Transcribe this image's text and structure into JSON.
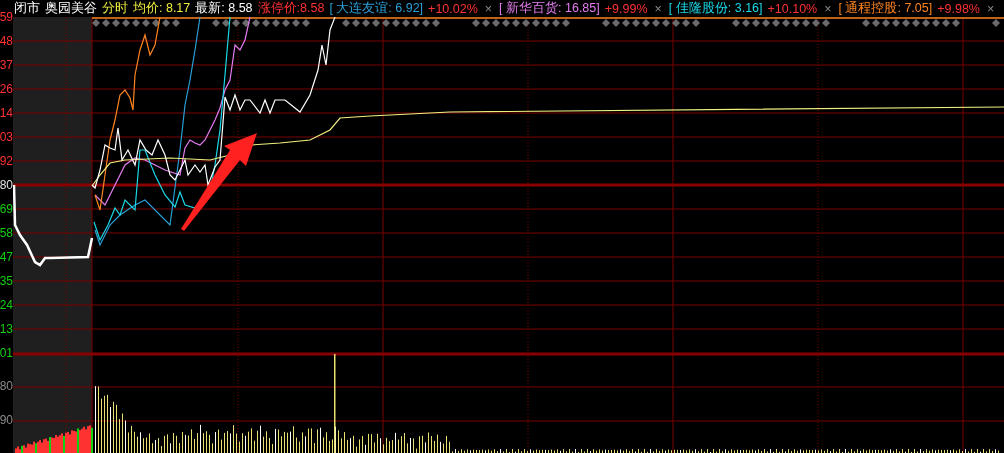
{
  "header": {
    "status": "闭市",
    "stock_name": "奥园美谷",
    "mode": "分时",
    "average": "均价: 8.17",
    "latest": "最新: 8.58",
    "limit_up": "涨停价:8.58"
  },
  "compare": [
    {
      "name": "[ 大连友谊: 6.92]",
      "change": "+10.02%",
      "close": "×",
      "color": "#2a9fd6"
    },
    {
      "name": "[ 新华百货: 16.85]",
      "change": "+9.99%",
      "close": "×",
      "color": "#e47cf0"
    },
    {
      "name": "[ 佳隆股份: 3.16]",
      "change": "+10.10%",
      "close": "×",
      "color": "#19d8e8"
    },
    {
      "name": "[ 通程控股: 7.05]",
      "change": "+9.98%",
      "close": "×",
      "color": "#ff8420"
    }
  ],
  "price_axis": [
    {
      "label": "59",
      "kind": "up"
    },
    {
      "label": "48",
      "kind": "up"
    },
    {
      "label": "37",
      "kind": "up"
    },
    {
      "label": "26",
      "kind": "up"
    },
    {
      "label": "14",
      "kind": "up"
    },
    {
      "label": "03",
      "kind": "up"
    },
    {
      "label": "92",
      "kind": "up"
    },
    {
      "label": "80",
      "kind": "flat"
    },
    {
      "label": "69",
      "kind": "down"
    },
    {
      "label": "58",
      "kind": "down"
    },
    {
      "label": "47",
      "kind": "down"
    },
    {
      "label": "35",
      "kind": "down"
    },
    {
      "label": "24",
      "kind": "down"
    },
    {
      "label": "13",
      "kind": "down"
    },
    {
      "label": "01",
      "kind": "down"
    }
  ],
  "volume_axis": [
    {
      "label": "80"
    },
    {
      "label": "90"
    }
  ]
}
